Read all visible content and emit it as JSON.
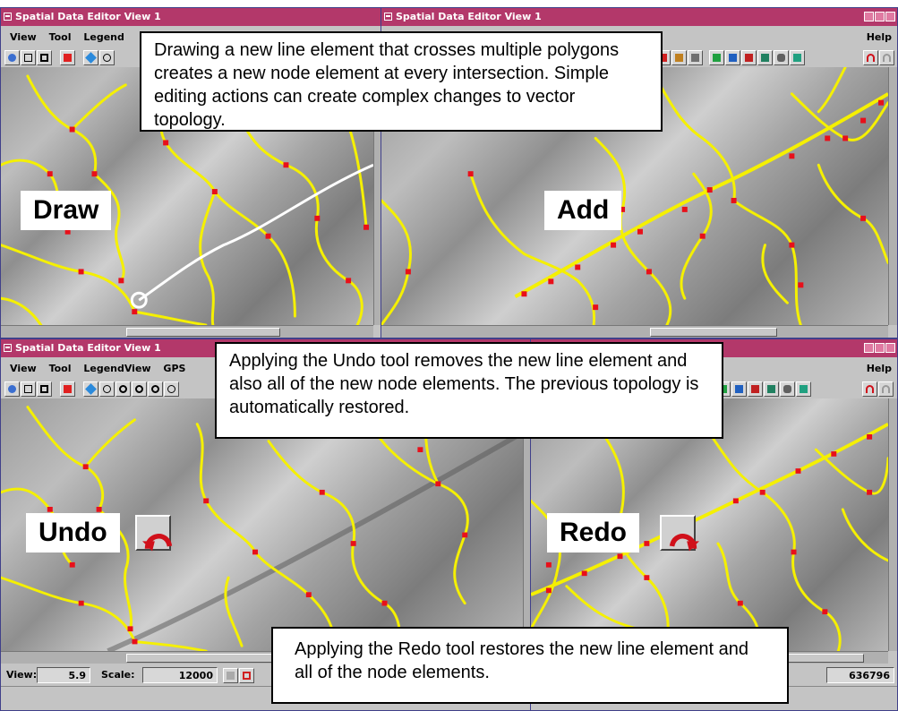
{
  "windows": [
    {
      "title": "Spatial Data Editor View 1",
      "menu": [
        "View",
        "Tool",
        "Legend"
      ],
      "help": "",
      "label": "Draw"
    },
    {
      "title": "Spatial Data Editor View 1",
      "menu": [],
      "help": "Help",
      "label": "Add"
    },
    {
      "title": "Spatial Data Editor View 1",
      "menu": [
        "View",
        "Tool",
        "LegendView",
        "GPS"
      ],
      "help": "",
      "label": "Undo"
    },
    {
      "title": "",
      "menu": [],
      "help": "Help",
      "label": "Redo"
    }
  ],
  "callouts": {
    "top": "Drawing a new line element that crosses multiple polygons creates a new node element at every intersection.  Simple editing actions can create complex changes to vector topology.",
    "middle": "Applying the Undo tool removes the new line element and also all of the new node elements. The previous topology is automatically restored.",
    "bottom": "Applying the Redo tool restores the new line element and all of the node elements."
  },
  "status": {
    "view_label": "View:",
    "view_value": "5.9",
    "scale_label": "Scale:",
    "scale_value": "12000",
    "coord_value": "636796"
  },
  "colors": {
    "titlebar": "#b3386a",
    "polygon_line": "#f5f000",
    "node": "#e8101a",
    "new_line_drawing": "#ffffff",
    "undo_arrow": "#d0101a"
  },
  "icons": [
    "undo-icon",
    "redo-icon",
    "zoom-icon",
    "select-icon"
  ]
}
